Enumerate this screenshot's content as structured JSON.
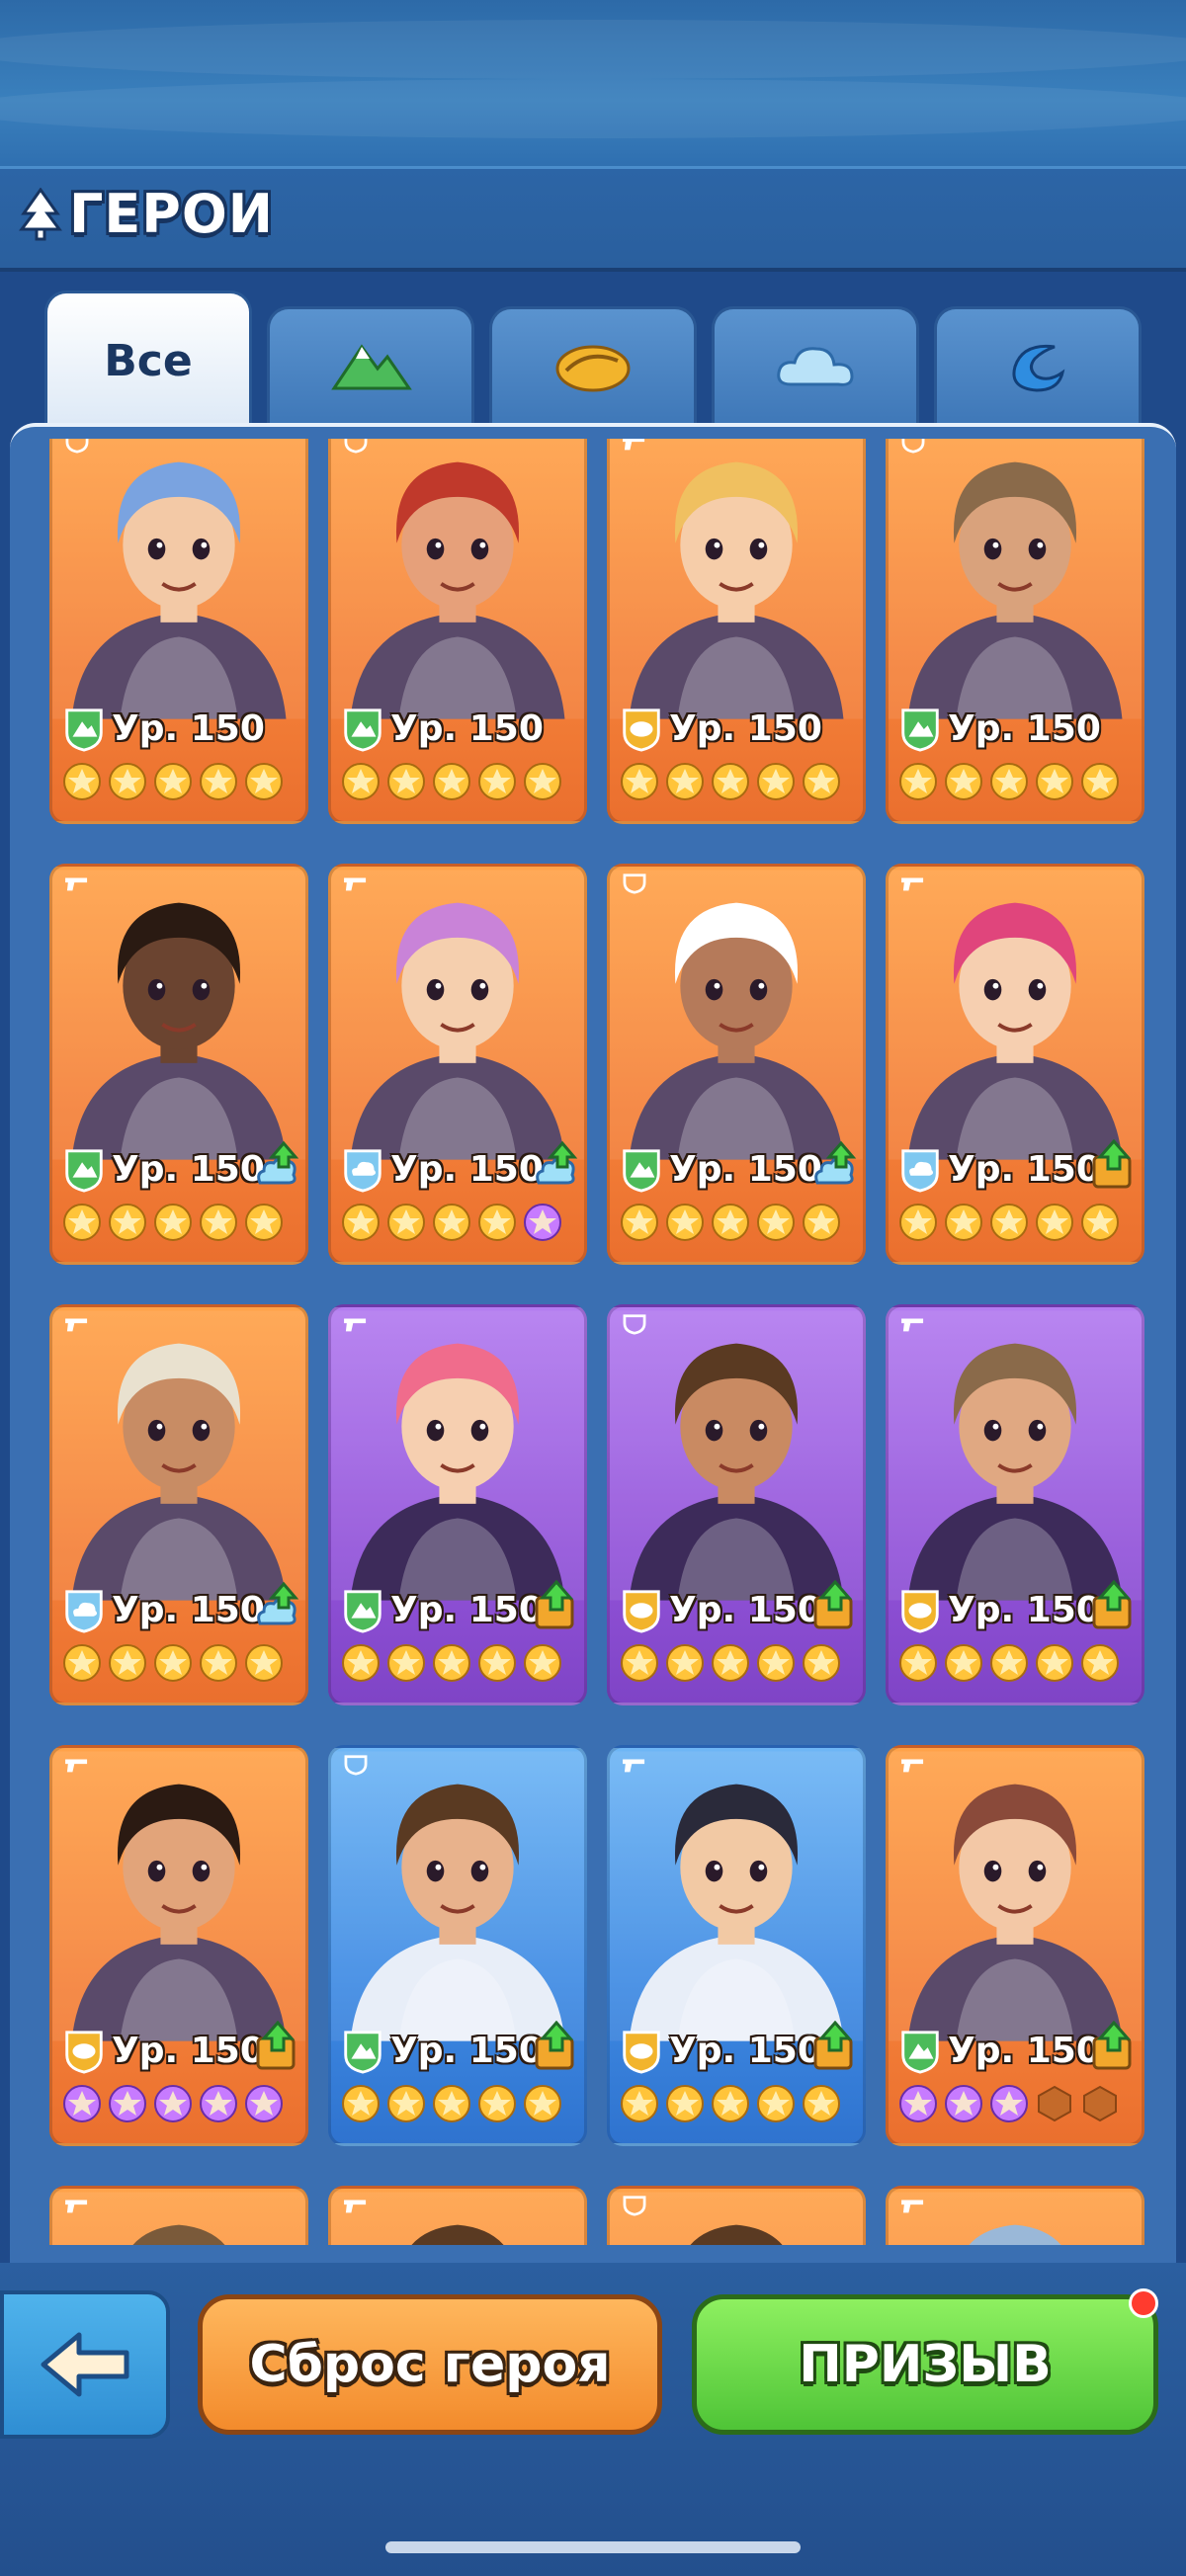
{
  "header": {
    "title": "ГЕРОИ"
  },
  "tabs": [
    {
      "label": "Все",
      "icon": "all-text",
      "active": true
    },
    {
      "label": "",
      "icon": "mountain-icon",
      "active": false
    },
    {
      "label": "",
      "icon": "sun-icon",
      "active": false
    },
    {
      "label": "",
      "icon": "cloud-icon",
      "active": false
    },
    {
      "label": "",
      "icon": "wave-icon",
      "active": false
    }
  ],
  "colors": {
    "orange": "#f5823a",
    "purple": "#9354da",
    "blue": "#3e8ae3",
    "mountain": "#4cbb5a",
    "sun": "#f2b42c",
    "cloud": "#7ec8f0",
    "wave": "#2f8de0",
    "star_gold": "#ffc43a",
    "star_purple": "#c77bff"
  },
  "heroes": [
    {
      "level": "Ур. 150",
      "bg": "orange",
      "faction": "mountain",
      "class": "shield",
      "upgrade": "",
      "stars": [
        "gold",
        "gold",
        "gold",
        "gold",
        "gold"
      ],
      "hair": "#7aa3e0",
      "skin": "#f3c9a6"
    },
    {
      "level": "Ур. 150",
      "bg": "orange",
      "faction": "mountain",
      "class": "shield",
      "upgrade": "",
      "stars": [
        "gold",
        "gold",
        "gold",
        "gold",
        "gold"
      ],
      "hair": "#c0392b",
      "skin": "#e6a07a"
    },
    {
      "level": "Ур. 150",
      "bg": "orange",
      "faction": "sun",
      "class": "gun",
      "upgrade": "",
      "stars": [
        "gold",
        "gold",
        "gold",
        "gold",
        "gold"
      ],
      "hair": "#f0c060",
      "skin": "#f6cda9"
    },
    {
      "level": "Ур. 150",
      "bg": "orange",
      "faction": "mountain",
      "class": "shield",
      "upgrade": "",
      "stars": [
        "gold",
        "gold",
        "gold",
        "gold",
        "gold"
      ],
      "hair": "#8a6a4a",
      "skin": "#d9a27c"
    },
    {
      "level": "Ур. 150",
      "bg": "orange",
      "faction": "mountain",
      "class": "gun",
      "upgrade": "cloud",
      "stars": [
        "gold",
        "gold",
        "gold",
        "gold",
        "gold"
      ],
      "hair": "#2a1a12",
      "skin": "#6b4430"
    },
    {
      "level": "Ур. 150",
      "bg": "orange",
      "faction": "cloud",
      "class": "gun",
      "upgrade": "cloud",
      "stars": [
        "gold",
        "gold",
        "gold",
        "gold",
        "purple"
      ],
      "hair": "#c983d8",
      "skin": "#f5cfae"
    },
    {
      "level": "Ур. 150",
      "bg": "orange",
      "faction": "mountain",
      "class": "shield",
      "upgrade": "cloud",
      "stars": [
        "gold",
        "gold",
        "gold",
        "gold",
        "gold"
      ],
      "hair": "#ffffff",
      "skin": "#b57a5a"
    },
    {
      "level": "Ур. 150",
      "bg": "orange",
      "faction": "cloud",
      "class": "gun",
      "upgrade": "book",
      "stars": [
        "gold",
        "gold",
        "gold",
        "gold",
        "gold"
      ],
      "hair": "#e0457c",
      "skin": "#f6cfb0"
    },
    {
      "level": "Ур. 150",
      "bg": "orange",
      "faction": "cloud",
      "class": "gun",
      "upgrade": "cloud",
      "stars": [
        "gold",
        "gold",
        "gold",
        "gold",
        "gold"
      ],
      "hair": "#e9e1cf",
      "skin": "#c88c64"
    },
    {
      "level": "Ур. 150",
      "bg": "purple",
      "faction": "mountain",
      "class": "gun",
      "upgrade": "book",
      "stars": [
        "gold",
        "gold",
        "gold",
        "gold",
        "gold"
      ],
      "hair": "#f06c8c",
      "skin": "#f6cfb0"
    },
    {
      "level": "Ур. 150",
      "bg": "purple",
      "faction": "sun",
      "class": "shield",
      "upgrade": "book",
      "stars": [
        "gold",
        "gold",
        "gold",
        "gold",
        "gold"
      ],
      "hair": "#5a3a22",
      "skin": "#c98a62"
    },
    {
      "level": "Ур. 150",
      "bg": "purple",
      "faction": "sun",
      "class": "gun",
      "upgrade": "book",
      "stars": [
        "gold",
        "gold",
        "gold",
        "gold",
        "gold"
      ],
      "hair": "#8a6a4a",
      "skin": "#e0a882"
    },
    {
      "level": "Ур. 150",
      "bg": "orange",
      "faction": "sun",
      "class": "gun",
      "upgrade": "book",
      "stars": [
        "purple",
        "purple",
        "purple",
        "purple",
        "purple"
      ],
      "hair": "#2b1a12",
      "skin": "#e2a47a"
    },
    {
      "level": "Ур. 150",
      "bg": "blue",
      "faction": "mountain",
      "class": "shield",
      "upgrade": "book",
      "stars": [
        "gold",
        "gold",
        "gold",
        "gold",
        "gold"
      ],
      "hair": "#5a3a22",
      "skin": "#e8b28c"
    },
    {
      "level": "Ур. 150",
      "bg": "blue",
      "faction": "sun",
      "class": "gun",
      "upgrade": "book",
      "stars": [
        "gold",
        "gold",
        "gold",
        "gold",
        "gold"
      ],
      "hair": "#2a2a3a",
      "skin": "#f2c9a4"
    },
    {
      "level": "Ур. 150",
      "bg": "orange",
      "faction": "mountain",
      "class": "gun",
      "upgrade": "book",
      "stars": [
        "purple",
        "purple",
        "purple",
        "empty",
        "empty"
      ],
      "hair": "#8a4a3a",
      "skin": "#f3c8a6"
    },
    {
      "level": "",
      "bg": "orange",
      "faction": "",
      "class": "gun",
      "upgrade": "",
      "stars": [],
      "hair": "#7a5a3a",
      "skin": "#e8b28c"
    },
    {
      "level": "",
      "bg": "orange",
      "faction": "",
      "class": "gun",
      "upgrade": "",
      "stars": [],
      "hair": "#5a3a22",
      "skin": "#e8b28c"
    },
    {
      "level": "",
      "bg": "orange",
      "faction": "",
      "class": "shield",
      "upgrade": "",
      "stars": [],
      "hair": "#5a3a22",
      "skin": "#e8b28c"
    },
    {
      "level": "",
      "bg": "orange",
      "faction": "",
      "class": "gun",
      "upgrade": "",
      "stars": [],
      "hair": "#9ab8d8",
      "skin": "#e8b28c"
    }
  ],
  "footer": {
    "back_icon": "arrow-left-icon",
    "reset_label": "Сброс героя",
    "summon_label": "ПРИЗЫВ",
    "summon_notification": true
  }
}
